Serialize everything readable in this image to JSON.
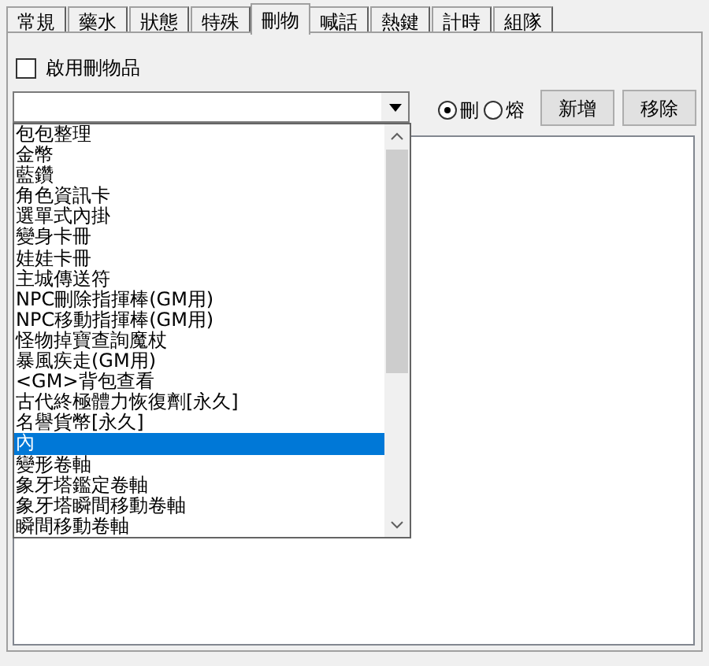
{
  "tabs": [
    {
      "label": "常規",
      "selected": false
    },
    {
      "label": "藥水",
      "selected": false
    },
    {
      "label": "狀態",
      "selected": false
    },
    {
      "label": "特殊",
      "selected": false
    },
    {
      "label": "刪物",
      "selected": true
    },
    {
      "label": "喊話",
      "selected": false
    },
    {
      "label": "熱鍵",
      "selected": false
    },
    {
      "label": "計時",
      "selected": false
    },
    {
      "label": "組隊",
      "selected": false
    }
  ],
  "enable_checkbox": {
    "label": "啟用刪物品",
    "checked": false
  },
  "radios": [
    {
      "label": "刪",
      "selected": true
    },
    {
      "label": "熔",
      "selected": false
    }
  ],
  "buttons": [
    "新增",
    "移除"
  ],
  "dropdown_items": [
    {
      "label": "包包整理",
      "selected": false
    },
    {
      "label": "金幣",
      "selected": false
    },
    {
      "label": "藍鑽",
      "selected": false
    },
    {
      "label": "角色資訊卡",
      "selected": false
    },
    {
      "label": "選單式內掛",
      "selected": false
    },
    {
      "label": "變身卡冊",
      "selected": false
    },
    {
      "label": "娃娃卡冊",
      "selected": false
    },
    {
      "label": "主城傳送符",
      "selected": false
    },
    {
      "label": "NPC刪除指揮棒(GM用)",
      "selected": false
    },
    {
      "label": "NPC移動指揮棒(GM用)",
      "selected": false
    },
    {
      "label": "怪物掉寶查詢魔杖",
      "selected": false
    },
    {
      "label": "暴風疾走(GM用)",
      "selected": false
    },
    {
      "label": "<GM>背包查看",
      "selected": false
    },
    {
      "label": "古代終極體力恢復劑[永久]",
      "selected": false
    },
    {
      "label": "名譽貨幣[永久]",
      "selected": false
    },
    {
      "label": "內",
      "selected": true
    },
    {
      "label": "變形卷軸",
      "selected": false
    },
    {
      "label": "象牙塔鑑定卷軸",
      "selected": false
    },
    {
      "label": "象牙塔瞬間移動卷軸",
      "selected": false
    },
    {
      "label": "瞬間移動卷軸",
      "selected": false
    }
  ]
}
